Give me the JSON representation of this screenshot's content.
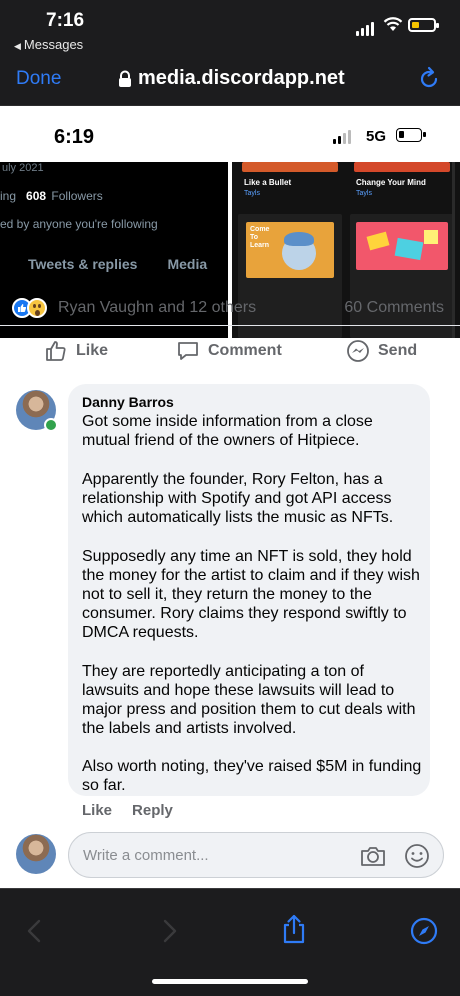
{
  "outer_status": {
    "time": "7:16",
    "back_label": "Messages"
  },
  "browser": {
    "done_label": "Done",
    "url": "media.discordapp.net",
    "accent": "#2f7bf6"
  },
  "inner_status": {
    "time": "6:19",
    "network": "5G"
  },
  "twitter_snippet": {
    "date_partial": "uly 2021",
    "following_partial": "ing",
    "followers_count": "608",
    "followers_label": "Followers",
    "followed_partial": "ed by anyone you're following",
    "tab_replies": "Tweets & replies",
    "tab_media": "Media"
  },
  "music_snippet": {
    "card1_title": "Like a Bullet",
    "card1_artist": "Tayls",
    "card2_title": "Change Your Mind",
    "card2_artist": "Tayls",
    "card3_title": "Come\nTo\nLearn"
  },
  "post": {
    "reactions_text": "Ryan Vaughn and 12 others",
    "comments_count": "60 Comments",
    "like_label": "Like",
    "comment_label": "Comment",
    "send_label": "Send"
  },
  "comment": {
    "author": "Danny Barros",
    "paragraphs": [
      "Got some inside information from a close mutual friend of the owners of Hitpiece.",
      "Apparently the founder, Rory Felton, has a relationship with Spotify and got API access which automatically lists the music as NFTs.",
      "Supposedly any time an NFT is sold, they hold the money for the artist to claim and if they wish not to sell it, they return the money to the consumer. Rory claims they respond swiftly to DMCA requests.",
      "They are reportedly anticipating a ton of lawsuits and hope these lawsuits will lead to major press and position them to cut deals with the labels and artists involved.",
      "Also worth noting, they've raised $5M in funding so far."
    ],
    "like_label": "Like",
    "reply_label": "Reply"
  },
  "composer": {
    "placeholder": "Write a comment..."
  }
}
